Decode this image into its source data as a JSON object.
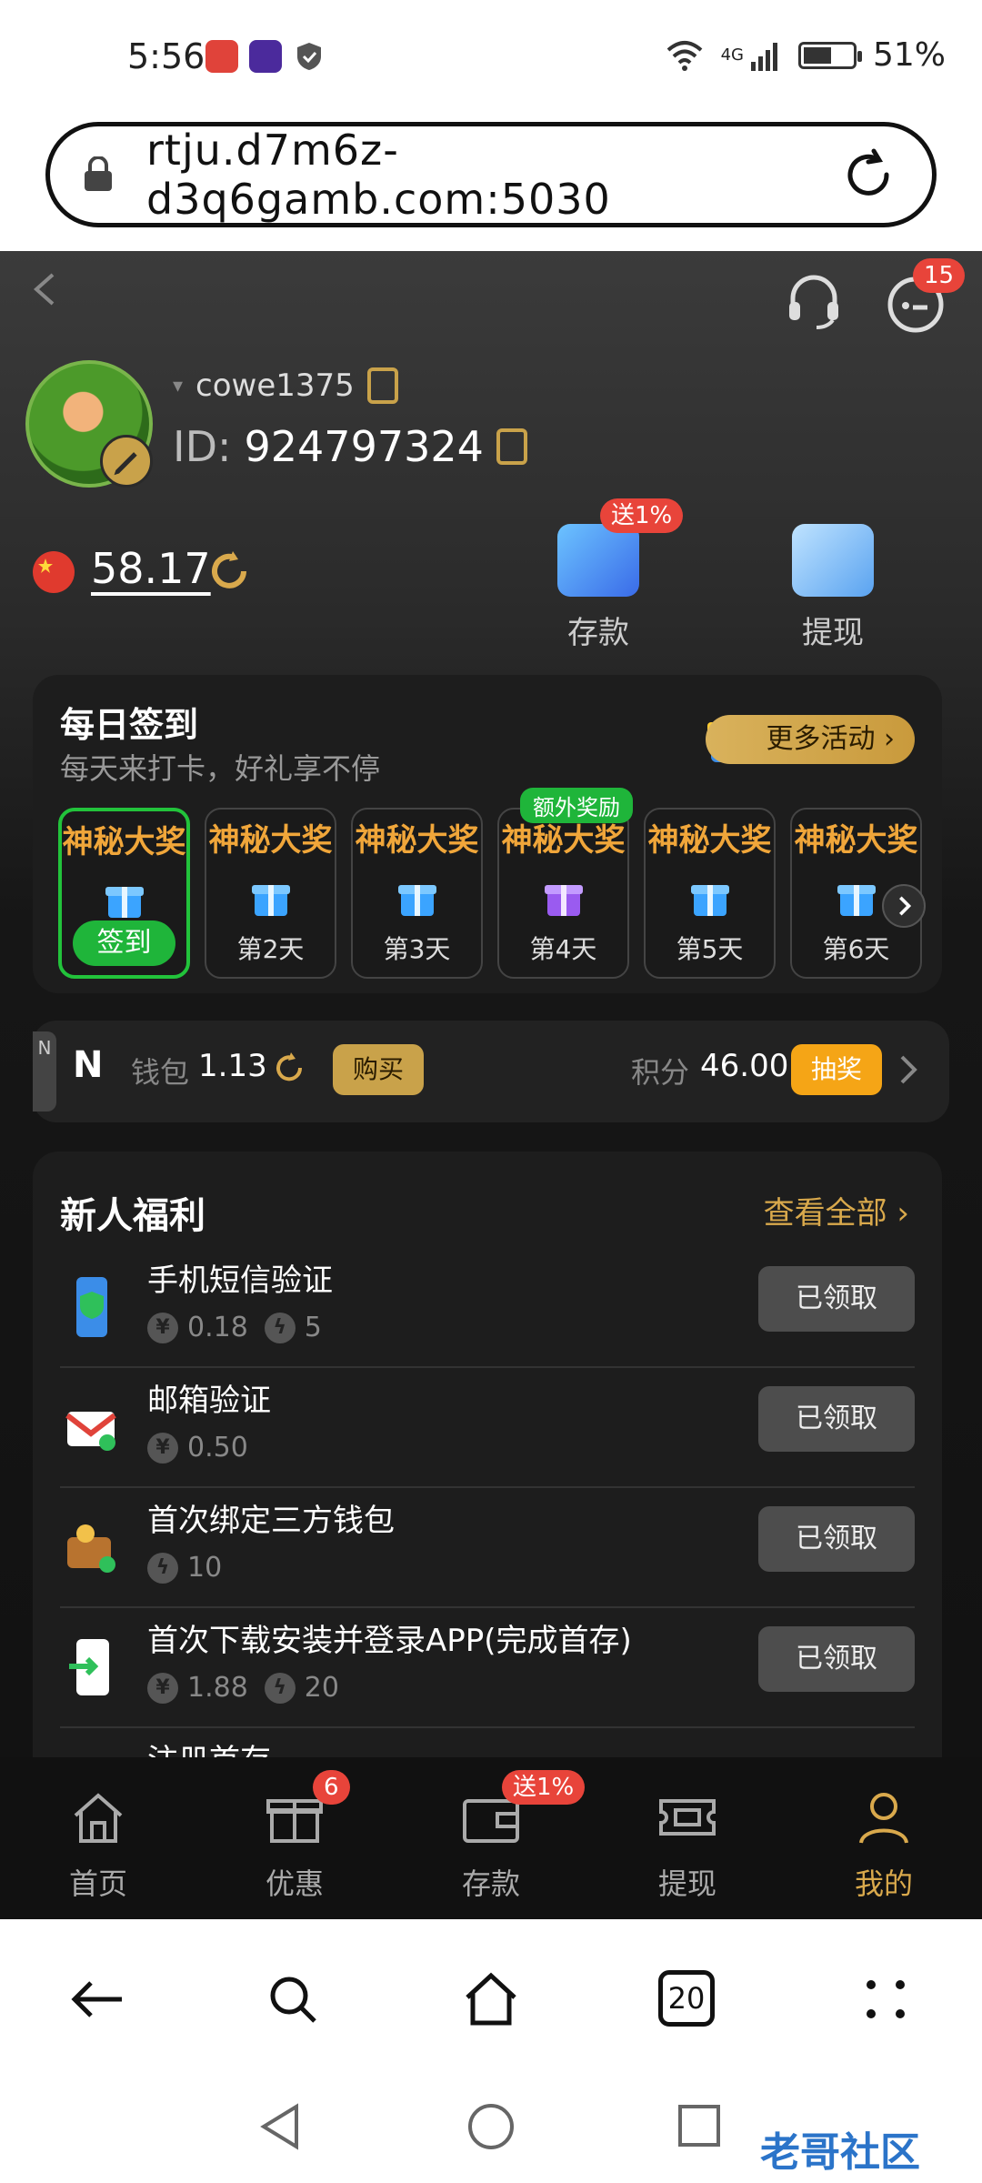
{
  "status_bar": {
    "time": "5:56",
    "network": "4G",
    "battery": "51%"
  },
  "browser": {
    "url": "rtju.d7m6z-d3q6gamb.com:5030",
    "tab_count": "20"
  },
  "header": {
    "message_badge": "15"
  },
  "profile": {
    "username": "cowe1375",
    "id_label": "ID:",
    "id_value": "924797324"
  },
  "balance": {
    "amount": "58.17"
  },
  "actions": {
    "deposit": {
      "label": "存款",
      "badge": "送1%"
    },
    "withdraw": {
      "label": "提现"
    }
  },
  "daily_signin": {
    "title": "每日签到",
    "subtitle": "每天来打卡，好礼享不停",
    "more_button": "更多活动",
    "extra_tag": "额外奖励",
    "days": [
      {
        "prize": "神秘大奖",
        "label": "签到",
        "active": true
      },
      {
        "prize": "神秘大奖",
        "label": "第2天"
      },
      {
        "prize": "神秘大奖",
        "label": "第3天"
      },
      {
        "prize": "神秘大奖",
        "label": "第4天"
      },
      {
        "prize": "神秘大奖",
        "label": "第5天"
      },
      {
        "prize": "神秘大奖",
        "label": "第6天"
      }
    ]
  },
  "wallet": {
    "logo": "N",
    "tab_letter": "N",
    "label": "钱包",
    "value": "1.13",
    "buy_button": "购买",
    "points_label": "积分",
    "points_value": "46.00",
    "draw_button": "抽奖"
  },
  "newbie": {
    "title": "新人福利",
    "view_all": "查看全部",
    "tasks": [
      {
        "name": "手机短信验证",
        "money": "0.18",
        "energy": "5",
        "button": "已领取"
      },
      {
        "name": "邮箱验证",
        "money": "0.50",
        "button": "已领取"
      },
      {
        "name": "首次绑定三方钱包",
        "energy": "10",
        "button": "已领取"
      },
      {
        "name": "首次下载安装并登录APP(完成首存)",
        "money": "1.88",
        "energy": "20",
        "button": "已领取"
      },
      {
        "name": "注册首存"
      }
    ]
  },
  "bottom_nav": [
    {
      "label": "首页"
    },
    {
      "label": "优惠",
      "badge": "6"
    },
    {
      "label": "存款",
      "badge": "送1%"
    },
    {
      "label": "提现"
    },
    {
      "label": "我的",
      "selected": true
    }
  ],
  "watermark": "老哥社区"
}
